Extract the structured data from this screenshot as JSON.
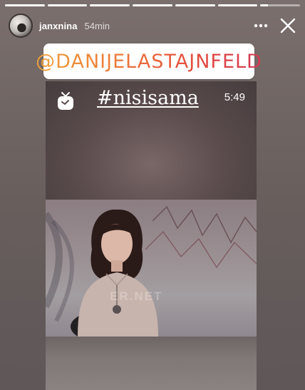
{
  "story": {
    "username": "janxnina",
    "timestamp": "54min",
    "progress_segments": [
      1,
      1,
      1,
      1,
      1,
      1,
      0.2
    ],
    "more_icon": "more-horizontal-icon",
    "close_icon": "close-icon"
  },
  "mention": {
    "text": "@DANIJELASTAJNFELD"
  },
  "shared_post": {
    "icon": "igtv-icon",
    "hashtag": "#nisisama",
    "duration": "5:49",
    "watermark": "ER.NET"
  },
  "colors": {
    "mention_gradient": [
      "#f0a23a",
      "#e44d3f",
      "#d33a55"
    ],
    "background": "#6f6563"
  }
}
